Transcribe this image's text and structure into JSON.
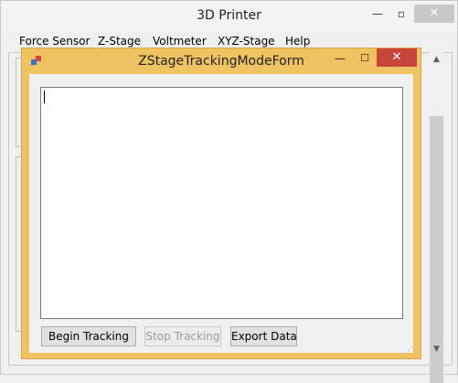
{
  "main_window": {
    "title": "3D Printer",
    "controls": {
      "minimize": "—",
      "maximize": "▫",
      "close": "✕"
    }
  },
  "menu": {
    "items": [
      "Force Sensor",
      "Z-Stage",
      "Voltmeter",
      "XYZ-Stage",
      "Help"
    ]
  },
  "child_window": {
    "title": "ZStageTrackingModeForm",
    "controls": {
      "minimize": "—",
      "maximize": "☐",
      "close": "✕"
    }
  },
  "tracking_text": {
    "value": ""
  },
  "buttons": {
    "begin": "Begin Tracking",
    "stop": "Stop Tracking",
    "export": "Export Data"
  },
  "scrollbar": {
    "up_arrow": "▲",
    "down_arrow": "▼"
  },
  "colors": {
    "child_frame": "#efc262",
    "child_close": "#c7453b"
  }
}
